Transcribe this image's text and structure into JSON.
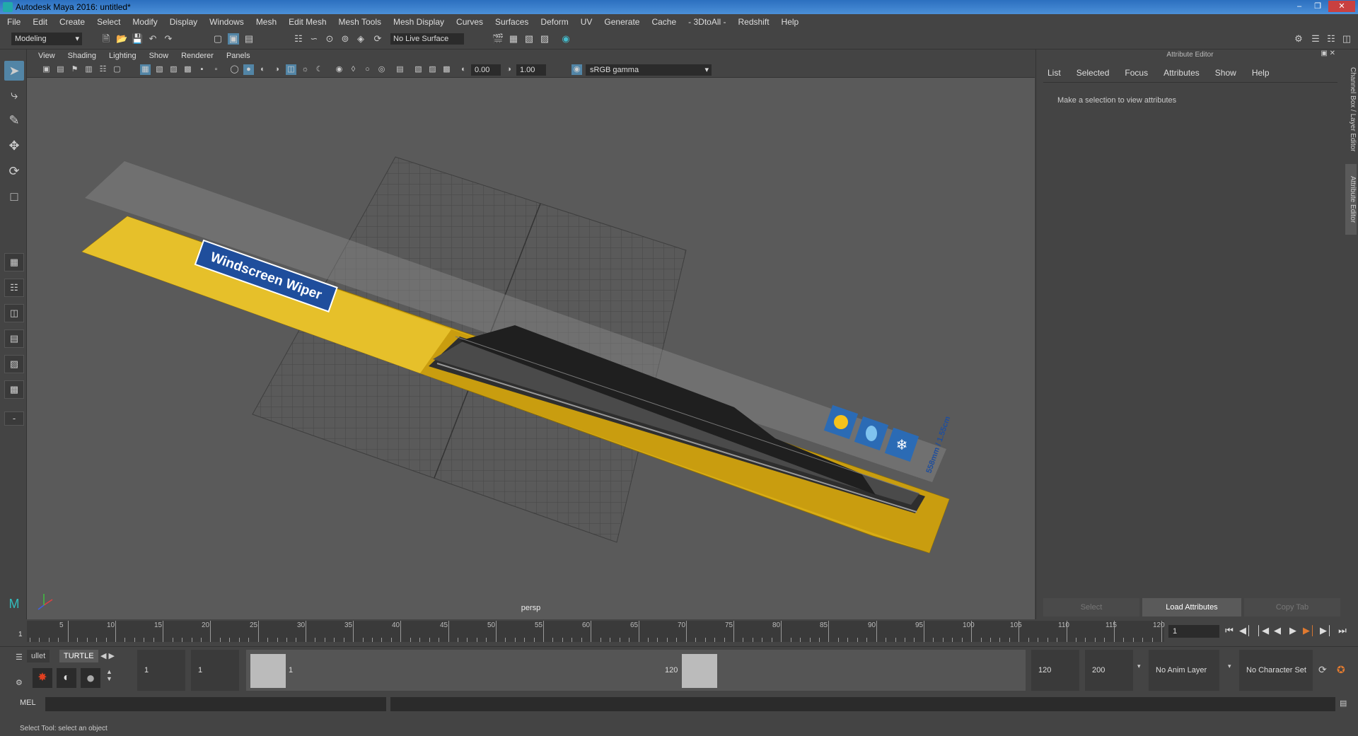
{
  "title": "Autodesk Maya 2016: untitled*",
  "menubar": [
    "File",
    "Edit",
    "Create",
    "Select",
    "Modify",
    "Display",
    "Windows",
    "Mesh",
    "Edit Mesh",
    "Mesh Tools",
    "Mesh Display",
    "Curves",
    "Surfaces",
    "Deform",
    "UV",
    "Generate",
    "Cache",
    "- 3DtoAll -",
    "Redshift",
    "Help"
  ],
  "shelf": {
    "mode": "Modeling",
    "live_surface": "No Live Surface"
  },
  "viewport": {
    "menu": [
      "View",
      "Shading",
      "Lighting",
      "Show",
      "Renderer",
      "Panels"
    ],
    "exposure": "0.00",
    "gamma_value": "1.00",
    "color_space": "sRGB gamma",
    "camera_label": "persp",
    "model_label": "Windscreen Wiper",
    "size_label": "558mm / 1.55cm"
  },
  "attribute_editor": {
    "header": "Attribute Editor",
    "menu": [
      "List",
      "Selected",
      "Focus",
      "Attributes",
      "Show",
      "Help"
    ],
    "message": "Make a selection to view attributes",
    "buttons": {
      "select": "Select",
      "load": "Load Attributes",
      "copy": "Copy Tab"
    }
  },
  "side_tabs": {
    "channel_box": "Channel Box / Layer Editor",
    "attr_editor": "Attribute Editor"
  },
  "timeline": {
    "ticks": [
      "5",
      "10",
      "15",
      "20",
      "25",
      "30",
      "35",
      "40",
      "45",
      "50",
      "55",
      "60",
      "65",
      "70",
      "75",
      "80",
      "85",
      "90",
      "95",
      "100",
      "105",
      "110",
      "115",
      "120"
    ],
    "start_label": "1",
    "current_frame": "1"
  },
  "range": {
    "shelf_tabs": [
      "ullet",
      "TURTLE"
    ],
    "start": "1",
    "playback_start": "1",
    "slider_start": "1",
    "slider_end": "120",
    "playback_end": "120",
    "end": "200",
    "anim_layer": "No Anim Layer",
    "character_set": "No Character Set"
  },
  "cmdline": {
    "label": "MEL"
  },
  "help_line": "Select Tool: select an object",
  "colors": {
    "accent": "#5285a6",
    "package_yellow": "#d9ad14",
    "label_blue": "#1f4e9c"
  }
}
